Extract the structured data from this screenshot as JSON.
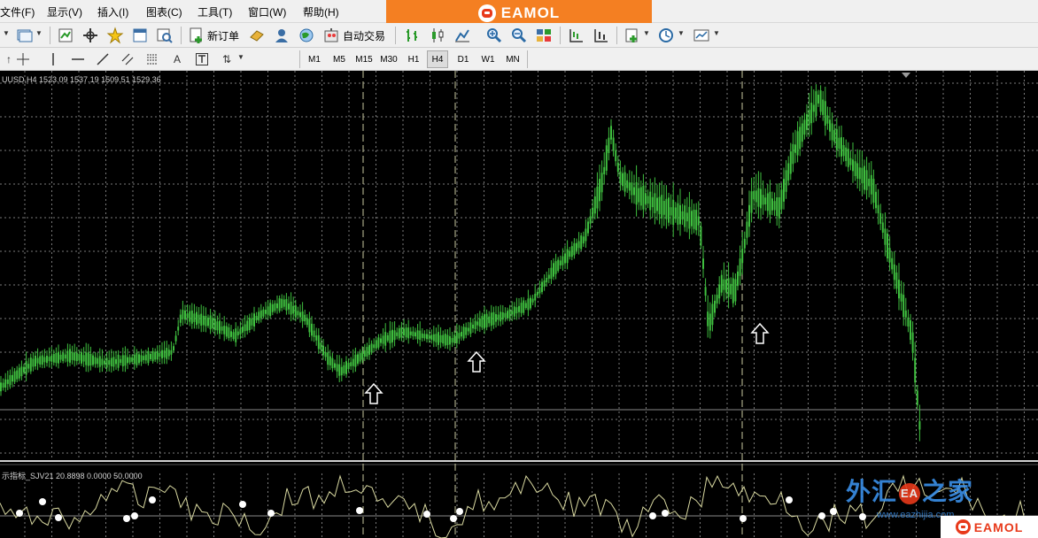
{
  "menu": {
    "items": [
      {
        "label": "文件(F)"
      },
      {
        "label": "显示(V)"
      },
      {
        "label": "插入(I)"
      },
      {
        "label": "图表(C)"
      },
      {
        "label": "工具(T)"
      },
      {
        "label": "窗口(W)"
      },
      {
        "label": "帮助(H)"
      }
    ]
  },
  "brand": {
    "name": "EAMOL",
    "color": "#f47f22"
  },
  "toolbar": {
    "new_order_label": "新订单",
    "auto_trade_label": "自动交易"
  },
  "timeframes": [
    {
      "label": "M1",
      "active": false
    },
    {
      "label": "M5",
      "active": false
    },
    {
      "label": "M15",
      "active": false
    },
    {
      "label": "M30",
      "active": false
    },
    {
      "label": "H1",
      "active": false
    },
    {
      "label": "H4",
      "active": true
    },
    {
      "label": "D1",
      "active": false
    },
    {
      "label": "W1",
      "active": false
    },
    {
      "label": "MN",
      "active": false
    }
  ],
  "chart": {
    "symbol_info": "UUSD,H4  1523.09 1537.19 1509.51 1529.36",
    "indicator_info": "示指标_SJV21 20.8898 0.0000 50.0000",
    "candle_color": "#3fbf3f",
    "grid_color": "#7a7a7a",
    "indicator_line_color": "#d8d8a0",
    "vline_color": "#c8c8a0"
  },
  "watermark": {
    "site_name_left": "外汇",
    "site_badge": "EA",
    "site_name_right": "之家",
    "site_url": "www.eazhijia.com",
    "brand_small": "EAMOL"
  }
}
